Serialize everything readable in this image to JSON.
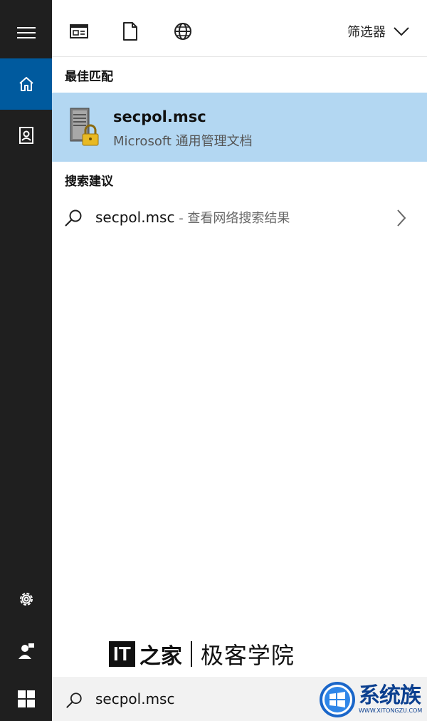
{
  "toolbar": {
    "filter_label": "筛选器",
    "icons": [
      "app-window-icon",
      "document-icon",
      "globe-icon",
      "chevron-down-icon"
    ]
  },
  "best_match": {
    "section_title": "最佳匹配",
    "title": "secpol.msc",
    "subtitle": "Microsoft 通用管理文档"
  },
  "suggestions": {
    "section_title": "搜索建议",
    "items": [
      {
        "query": "secpol.msc",
        "desc": " - 查看网络搜索结果"
      }
    ]
  },
  "rail": {
    "items": [
      "hamburger-menu-icon",
      "home-icon",
      "notebook-icon",
      "settings-gear-icon",
      "feedback-person-icon"
    ]
  },
  "search_box": {
    "value": "secpol.msc"
  },
  "watermark": {
    "it_label": "IT",
    "zhi_label": "之家",
    "brand_text": "极客学院"
  },
  "site_logo": {
    "cn_text": "系统族",
    "en_text": "WWW.XITONGZU.COM"
  },
  "colors": {
    "rail_bg": "#1f1f1f",
    "active_blue": "#005a9e",
    "selection_blue": "#b3d7f2",
    "taskbar_bg": "#f2f2f2"
  }
}
